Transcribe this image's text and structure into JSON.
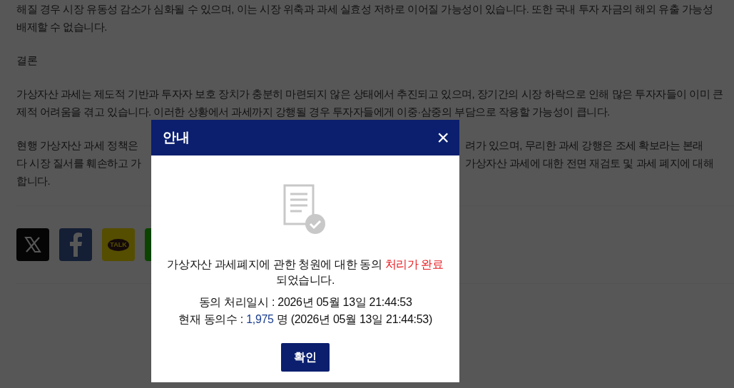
{
  "article": {
    "paragraphs": [
      {
        "lines": [
          [
            "해질 경우 시장 유동성 감소가 심화될 수 있으며, 이는 시장 위축과 과세 실효성 저하로 이어질 가능성이 있습니다. 또한 국내 투자 자금의 해외 유출 가능성"
          ],
          [
            "배제할 수 없습니다."
          ]
        ]
      },
      {
        "lines": [
          [
            "결론"
          ]
        ]
      },
      {
        "lines": [
          [
            "가상자산 과세는 제도적 기반과 투자자 보호 장치가 충분히 마련되지 않은 상태에서 추진되고 있으며, 장기간의 시장 하락으로 인해 많은 투자자들이 이미 큰"
          ],
          [
            "제적 어려움을 겪고 있습니다. 이러한 상황에서 과세까지 강행될 경우 투자자들에게 이중·삼중의 부담으로 작용할 가능성이 큽니다."
          ]
        ]
      },
      {
        "lines": [
          [
            "현행 가상자산 과세 정책은",
            "려가 있으며, 무리한 과세 강행은 조세 확보라는 본래"
          ],
          [
            "다 시장 질서를 훼손하고 가",
            "가상자산 과세에 대한 전면 재검토 및 과세 폐지에 대해"
          ],
          [
            "합니다."
          ]
        ]
      }
    ]
  },
  "share_buttons": [
    {
      "kind": "x"
    },
    {
      "kind": "facebook"
    },
    {
      "kind": "talk",
      "label": "TALK"
    },
    {
      "kind": "green"
    }
  ],
  "dialog": {
    "title": "안내",
    "close": "×",
    "message": [
      {
        "text": "가상자산 과세폐지에 관한 청원에 대한 동의 ",
        "kind": "plain"
      },
      {
        "text": "처리가 완료",
        "kind": "alert"
      },
      {
        "text": "되었습니다.",
        "kind": "plain"
      }
    ],
    "processed_line": [
      {
        "text": "동의 처리일시 : 2026년 05월 13일 21:44:53",
        "kind": "plain"
      }
    ],
    "count_line": [
      {
        "text": "현재 동의수 : ",
        "kind": "plain"
      },
      {
        "text": "1,975",
        "kind": "count"
      },
      {
        "text": " 명 (2026년 05월 13일 21:44:53)",
        "kind": "plain"
      }
    ],
    "confirm_button": "확인"
  }
}
